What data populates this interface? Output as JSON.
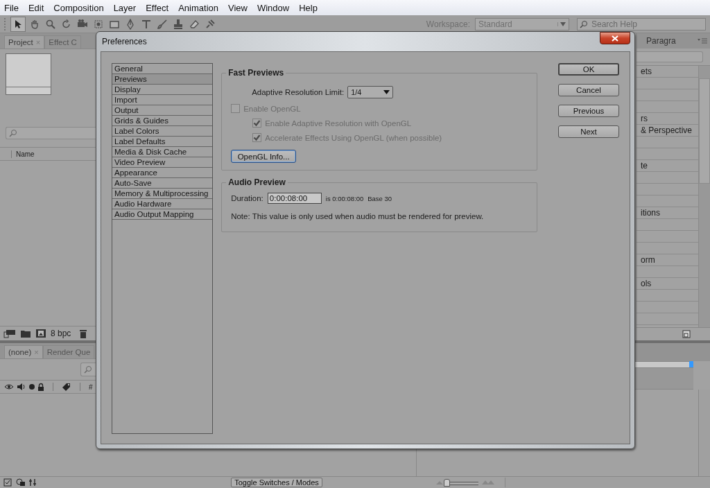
{
  "menu": [
    "File",
    "Edit",
    "Composition",
    "Layer",
    "Effect",
    "Animation",
    "View",
    "Window",
    "Help"
  ],
  "toolbar": {
    "workspace_label": "Workspace:",
    "workspace": "Standard",
    "search": {
      "placeholder": "Search Help"
    }
  },
  "project_panel": {
    "tabs": [
      {
        "label": "Project",
        "selected": true,
        "close": "×"
      },
      {
        "label": "Effect C",
        "selected": false
      }
    ],
    "column": "Name",
    "bit_depth": "8 bpc"
  },
  "timeline_panel": {
    "tabs": [
      {
        "label": "(none)",
        "selected": true,
        "close": "×"
      },
      {
        "label": "Render Que",
        "selected": false
      }
    ],
    "column": "#"
  },
  "right_panel": {
    "tab": "Paragra",
    "items": [
      {
        "kind": "text",
        "label": "ets"
      },
      {
        "kind": "blank"
      },
      {
        "kind": "blank"
      },
      {
        "kind": "blank"
      },
      {
        "kind": "text",
        "label": "rs"
      },
      {
        "kind": "text",
        "label": "& Perspective"
      },
      {
        "kind": "blank"
      },
      {
        "kind": "blank"
      },
      {
        "kind": "text",
        "label": "te"
      },
      {
        "kind": "blank"
      },
      {
        "kind": "blank"
      },
      {
        "kind": "blank"
      },
      {
        "kind": "text",
        "label": "itions"
      },
      {
        "kind": "blank"
      },
      {
        "kind": "blank"
      },
      {
        "kind": "blank"
      },
      {
        "kind": "text",
        "label": "orm"
      },
      {
        "kind": "blank"
      },
      {
        "kind": "text",
        "label": "ols"
      },
      {
        "kind": "blank"
      },
      {
        "kind": "blank"
      },
      {
        "kind": "blank"
      }
    ]
  },
  "dialog": {
    "title": "Preferences",
    "categories": [
      {
        "label": "General",
        "selected": false
      },
      {
        "label": "Previews",
        "selected": true
      },
      {
        "label": "Display",
        "selected": false
      },
      {
        "label": "Import",
        "selected": false
      },
      {
        "label": "Output",
        "selected": false
      },
      {
        "label": "Grids & Guides",
        "selected": false
      },
      {
        "label": "Label Colors",
        "selected": false
      },
      {
        "label": "Label Defaults",
        "selected": false
      },
      {
        "label": "Media & Disk Cache",
        "selected": false
      },
      {
        "label": "Video Preview",
        "selected": false
      },
      {
        "label": "Appearance",
        "selected": false
      },
      {
        "label": "Auto-Save",
        "selected": false
      },
      {
        "label": "Memory & Multiprocessing",
        "selected": false
      },
      {
        "label": "Audio Hardware",
        "selected": false
      },
      {
        "label": "Audio Output Mapping",
        "selected": false
      }
    ],
    "fast_previews": {
      "title": "Fast Previews",
      "resolution_label": "Adaptive Resolution Limit:",
      "resolution": "1/4",
      "options": [
        {
          "label": "Enable OpenGL",
          "checked": false,
          "disabled": true,
          "children": [
            {
              "label": "Enable Adaptive Resolution with OpenGL",
              "checked": true,
              "disabled": true
            },
            {
              "label": "Accelerate Effects Using OpenGL (when possible)",
              "checked": true,
              "disabled": true
            }
          ]
        }
      ],
      "info_button": "OpenGL Info..."
    },
    "audio_preview": {
      "title": "Audio Preview",
      "duration_label": "Duration:",
      "duration": "0:00:08:00",
      "duration_info": "is 0:00:08:00",
      "base": "Base 30",
      "note": "Note: This value is only used when audio must be rendered for preview."
    },
    "buttons": [
      {
        "label": "OK",
        "default": true
      },
      {
        "label": "Cancel",
        "default": false
      },
      {
        "label": "Previous",
        "default": false
      },
      {
        "label": "Next",
        "default": false
      }
    ]
  },
  "status_bar": {
    "toggle": "Toggle Switches / Modes",
    "zoom": {
      "level": 0
    }
  }
}
